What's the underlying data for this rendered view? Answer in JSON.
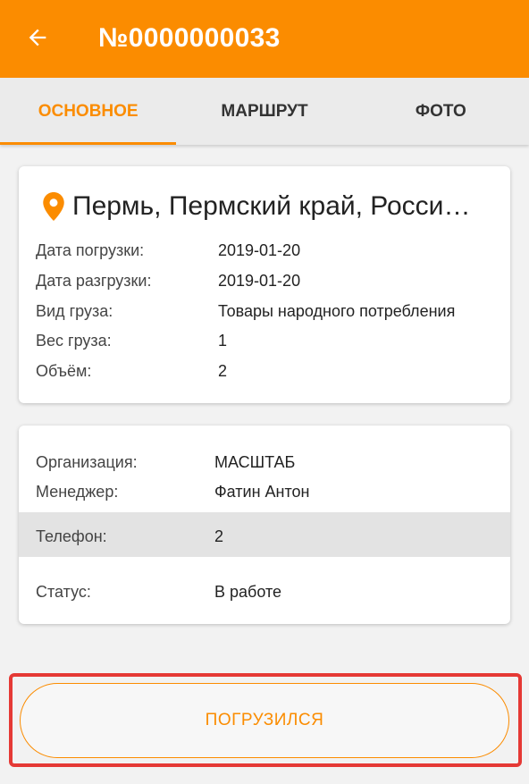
{
  "appbar": {
    "title": "№0000000033",
    "back_icon": "arrow-left-icon"
  },
  "tabs": [
    {
      "label": "ОСНОВНОЕ",
      "active": true
    },
    {
      "label": "МАРШРУТ",
      "active": false
    },
    {
      "label": "ФОТО",
      "active": false
    }
  ],
  "location": {
    "icon": "map-pin-icon",
    "text": "Пермь, Пермский край, Росси…"
  },
  "cargo": {
    "load_date_label": "Дата погрузки:",
    "load_date": "2019-01-20",
    "unload_date_label": "Дата разгрузки:",
    "unload_date": "2019-01-20",
    "type_label": "Вид груза:",
    "type": "Товары народного потребления",
    "weight_label": "Вес груза:",
    "weight": "1",
    "volume_label": "Объём:",
    "volume": "2"
  },
  "contact": {
    "org_label": "Организация:",
    "org": "МАСШТАБ",
    "manager_label": "Менеджер:",
    "manager": "Фатин Антон",
    "phone_label": "Телефон:",
    "phone": "2",
    "status_label": "Статус:",
    "status": "В работе"
  },
  "action": {
    "label": "ПОГРУЗИЛСЯ"
  },
  "colors": {
    "accent": "#fb8c00",
    "highlight_frame": "#e53935"
  }
}
